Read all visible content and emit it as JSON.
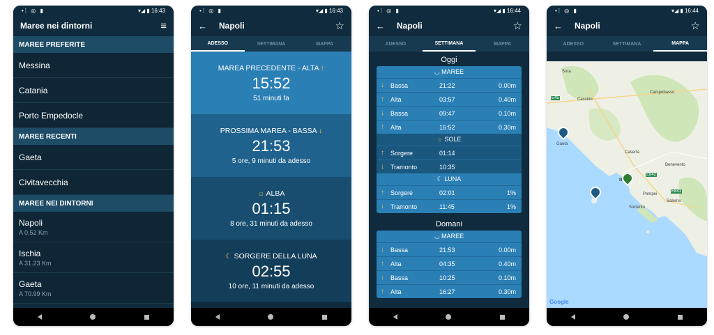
{
  "status": {
    "icons_left": "•⁞ ◎ ▮",
    "icons_right": "▾◢ ▮",
    "time1": "16:43",
    "time2": "16:43",
    "time3": "16:44",
    "time4": "16:44"
  },
  "screen1": {
    "title": "Maree nei dintorni",
    "menu_icon": "≡",
    "sec_fav": "MAREE PREFERITE",
    "fav": [
      "Messina",
      "Catania",
      "Porto Empedocle"
    ],
    "sec_recent": "MAREE RECENTI",
    "recent": [
      "Gaeta",
      "Civitavecchia"
    ],
    "sec_near": "MAREE NEI DINTORNI",
    "near": [
      {
        "name": "Napoli",
        "dist": "A 0.52 Km"
      },
      {
        "name": "Ischia",
        "dist": "A 31.23 Km"
      },
      {
        "name": "Gaeta",
        "dist": "A 70.99 Km"
      }
    ]
  },
  "common": {
    "city": "Napoli",
    "back": "←",
    "star": "☆",
    "tab_now": "ADESSO",
    "tab_week": "SETTIMANA",
    "tab_map": "MAPPA"
  },
  "screen2": {
    "blocks": [
      {
        "label": "MAREA PRECEDENTE - ALTA",
        "arrow": "↑",
        "time": "15:52",
        "sub": "51 minuti fa",
        "color": "#2a7fb5"
      },
      {
        "label": "PROSSIMA MAREA - BASSA",
        "arrow": "↓",
        "time": "21:53",
        "sub": "5 ore, 9 minuti da adesso",
        "color": "#1f628d"
      },
      {
        "label": "ALBA",
        "arrow": "☼",
        "time": "01:15",
        "sub": "8 ore, 31 minuti da adesso",
        "color": "#184d70"
      },
      {
        "label": "SORGERE DELLA LUNA",
        "arrow": "☾",
        "time": "02:55",
        "sub": "10 ore, 11 minuti da adesso",
        "color": "#133e5a"
      }
    ]
  },
  "screen3": {
    "today": "Oggi",
    "tomorrow": "Domani",
    "maree_label": "MAREE",
    "sole_label": "SOLE",
    "luna_label": "LUNA",
    "today_tides": [
      {
        "arrow": "↓",
        "name": "Bassa",
        "time": "21:22",
        "val": "0.00m"
      },
      {
        "arrow": "↑",
        "name": "Alta",
        "time": "03:57",
        "val": "0.40m"
      },
      {
        "arrow": "↓",
        "name": "Bassa",
        "time": "09:47",
        "val": "0.10m"
      },
      {
        "arrow": "↑",
        "name": "Alta",
        "time": "15:52",
        "val": "0.30m"
      }
    ],
    "sun": [
      {
        "arrow": "↑",
        "name": "Sorgere",
        "time": "01:14",
        "val": ""
      },
      {
        "arrow": "↓",
        "name": "Tramonto",
        "time": "10:35",
        "val": ""
      }
    ],
    "moon": [
      {
        "arrow": "↑",
        "name": "Sorgere",
        "time": "02:01",
        "val": "1%"
      },
      {
        "arrow": "↓",
        "name": "Tramonto",
        "time": "11:45",
        "val": "1%"
      }
    ],
    "tomorrow_tides": [
      {
        "arrow": "↓",
        "name": "Bassa",
        "time": "21:53",
        "val": "0.00m"
      },
      {
        "arrow": "↑",
        "name": "Alta",
        "time": "04:35",
        "val": "0.40m"
      },
      {
        "arrow": "↓",
        "name": "Bassa",
        "time": "10:25",
        "val": "0.10m"
      },
      {
        "arrow": "↑",
        "name": "Alta",
        "time": "16:27",
        "val": "0.30m"
      }
    ]
  },
  "screen4": {
    "labels": {
      "sora": "Sora",
      "cassino": "Cassino",
      "campobasso": "Campobasso",
      "gaeta": "Gaeta",
      "caserta": "Caserta",
      "benevento": "Benevento",
      "napoli": "Napoli",
      "pompei": "Pompei",
      "sorrento": "Sorrento",
      "salerno": "Salerno",
      "r45": "E45",
      "r842": "E842",
      "r841": "E841"
    },
    "google": "Google"
  },
  "colors": {
    "bg": "#0f2b3d",
    "accent": "#f2c14e",
    "card": "#2a7fb5"
  }
}
